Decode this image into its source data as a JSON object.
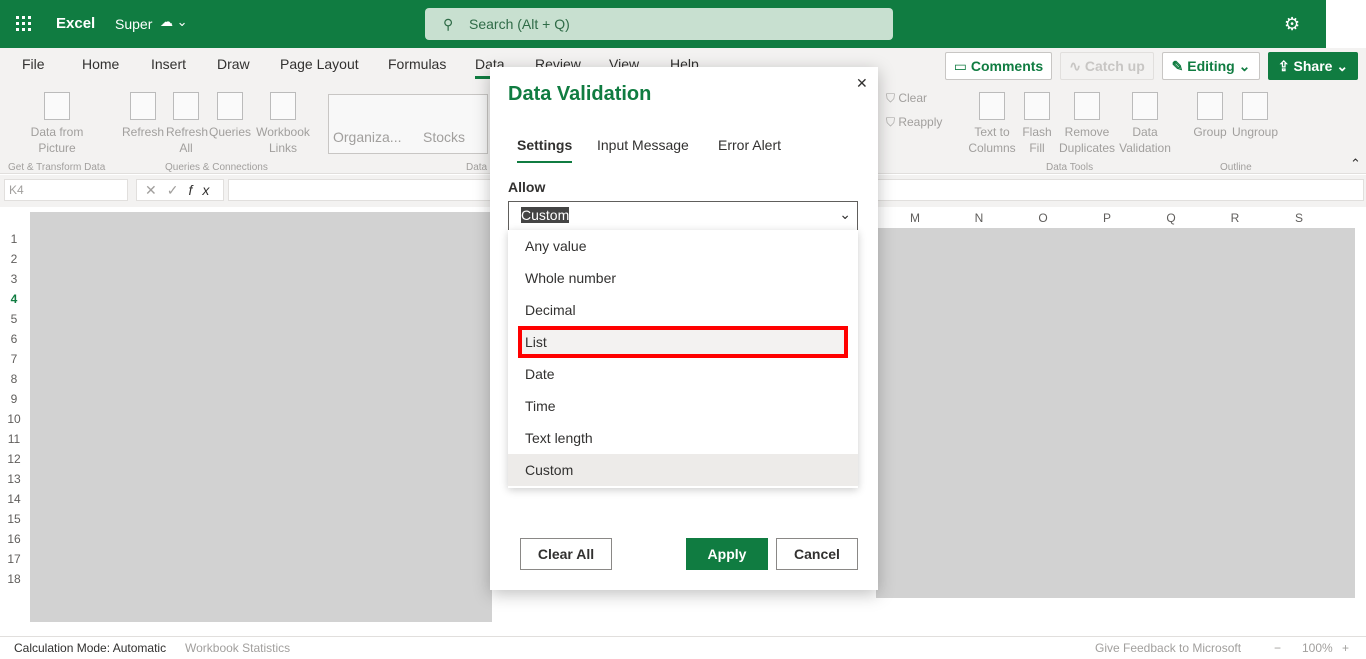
{
  "app": {
    "name": "Excel",
    "doc": "Super",
    "search_placeholder": "Search (Alt + Q)"
  },
  "menu": [
    "File",
    "Home",
    "Insert",
    "Draw",
    "Page Layout",
    "Formulas",
    "Data",
    "Review",
    "View",
    "Help"
  ],
  "active_menu": "Data",
  "top_buttons": {
    "comments": "Comments",
    "catch_up": "Catch up",
    "editing": "Editing",
    "share": "Share"
  },
  "ribbon": {
    "data_from_picture": "Data from Picture",
    "group_get": "Get & Transform Data",
    "refresh": "Refresh",
    "refresh_all": "Refresh All",
    "queries": "Queries",
    "workbook_links": "Workbook Links",
    "group_queries": "Queries & Connections",
    "organization": "Organiza...",
    "stocks": "Stocks",
    "group_data": "Data",
    "clear": "Clear",
    "reapply": "Reapply",
    "text_to_columns": "Text to Columns",
    "flash_fill": "Flash Fill",
    "remove_duplicates": "Remove Duplicates",
    "data_validation": "Data Validation",
    "group_tools": "Data Tools",
    "group": "Group",
    "ungroup": "Ungroup",
    "group_outline": "Outline"
  },
  "formula_bar": {
    "name_box": "K4",
    "fx": "fx"
  },
  "columns": [
    "M",
    "N",
    "O",
    "P",
    "Q",
    "R",
    "S"
  ],
  "rows": [
    "1",
    "2",
    "3",
    "4",
    "5",
    "6",
    "7",
    "8",
    "9",
    "10",
    "11",
    "12",
    "13",
    "14",
    "15",
    "16",
    "17",
    "18"
  ],
  "status": {
    "calc": "Calculation Mode: Automatic",
    "stats": "Workbook Statistics",
    "feedback": "Give Feedback to Microsoft",
    "zoom": "100%"
  },
  "dialog": {
    "title": "Data Validation",
    "tabs": [
      "Settings",
      "Input Message",
      "Error Alert"
    ],
    "allow_label": "Allow",
    "allow_value": "Custom",
    "options": [
      "Any value",
      "Whole number",
      "Decimal",
      "List",
      "Date",
      "Time",
      "Text length",
      "Custom"
    ],
    "highlighted_option": "List",
    "clear_all": "Clear All",
    "apply": "Apply",
    "cancel": "Cancel"
  },
  "colors": {
    "brand": "#107c41",
    "highlight_border": "#ff0000"
  }
}
